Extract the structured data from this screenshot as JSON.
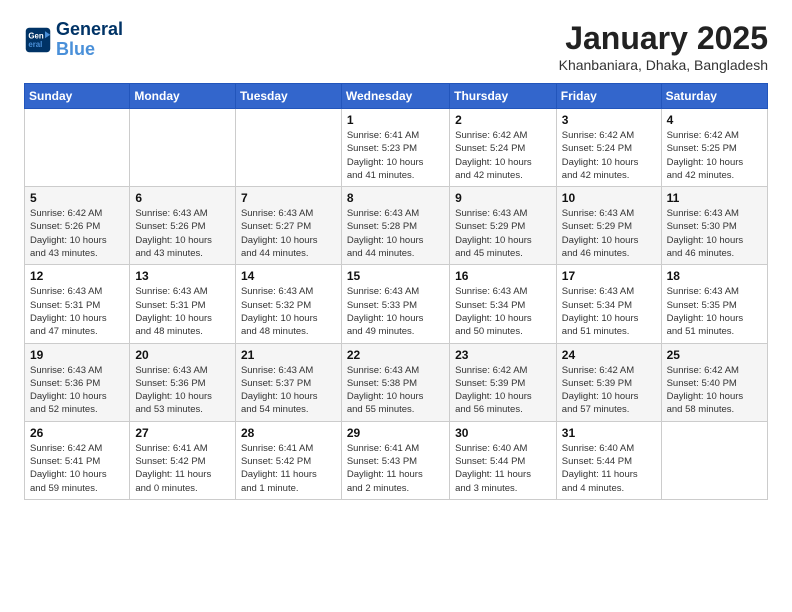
{
  "header": {
    "logo_line1": "General",
    "logo_line2": "Blue",
    "month_title": "January 2025",
    "location": "Khanbaniara, Dhaka, Bangladesh"
  },
  "days_of_week": [
    "Sunday",
    "Monday",
    "Tuesday",
    "Wednesday",
    "Thursday",
    "Friday",
    "Saturday"
  ],
  "weeks": [
    [
      {
        "day": "",
        "info": ""
      },
      {
        "day": "",
        "info": ""
      },
      {
        "day": "",
        "info": ""
      },
      {
        "day": "1",
        "info": "Sunrise: 6:41 AM\nSunset: 5:23 PM\nDaylight: 10 hours\nand 41 minutes."
      },
      {
        "day": "2",
        "info": "Sunrise: 6:42 AM\nSunset: 5:24 PM\nDaylight: 10 hours\nand 42 minutes."
      },
      {
        "day": "3",
        "info": "Sunrise: 6:42 AM\nSunset: 5:24 PM\nDaylight: 10 hours\nand 42 minutes."
      },
      {
        "day": "4",
        "info": "Sunrise: 6:42 AM\nSunset: 5:25 PM\nDaylight: 10 hours\nand 42 minutes."
      }
    ],
    [
      {
        "day": "5",
        "info": "Sunrise: 6:42 AM\nSunset: 5:26 PM\nDaylight: 10 hours\nand 43 minutes."
      },
      {
        "day": "6",
        "info": "Sunrise: 6:43 AM\nSunset: 5:26 PM\nDaylight: 10 hours\nand 43 minutes."
      },
      {
        "day": "7",
        "info": "Sunrise: 6:43 AM\nSunset: 5:27 PM\nDaylight: 10 hours\nand 44 minutes."
      },
      {
        "day": "8",
        "info": "Sunrise: 6:43 AM\nSunset: 5:28 PM\nDaylight: 10 hours\nand 44 minutes."
      },
      {
        "day": "9",
        "info": "Sunrise: 6:43 AM\nSunset: 5:29 PM\nDaylight: 10 hours\nand 45 minutes."
      },
      {
        "day": "10",
        "info": "Sunrise: 6:43 AM\nSunset: 5:29 PM\nDaylight: 10 hours\nand 46 minutes."
      },
      {
        "day": "11",
        "info": "Sunrise: 6:43 AM\nSunset: 5:30 PM\nDaylight: 10 hours\nand 46 minutes."
      }
    ],
    [
      {
        "day": "12",
        "info": "Sunrise: 6:43 AM\nSunset: 5:31 PM\nDaylight: 10 hours\nand 47 minutes."
      },
      {
        "day": "13",
        "info": "Sunrise: 6:43 AM\nSunset: 5:31 PM\nDaylight: 10 hours\nand 48 minutes."
      },
      {
        "day": "14",
        "info": "Sunrise: 6:43 AM\nSunset: 5:32 PM\nDaylight: 10 hours\nand 48 minutes."
      },
      {
        "day": "15",
        "info": "Sunrise: 6:43 AM\nSunset: 5:33 PM\nDaylight: 10 hours\nand 49 minutes."
      },
      {
        "day": "16",
        "info": "Sunrise: 6:43 AM\nSunset: 5:34 PM\nDaylight: 10 hours\nand 50 minutes."
      },
      {
        "day": "17",
        "info": "Sunrise: 6:43 AM\nSunset: 5:34 PM\nDaylight: 10 hours\nand 51 minutes."
      },
      {
        "day": "18",
        "info": "Sunrise: 6:43 AM\nSunset: 5:35 PM\nDaylight: 10 hours\nand 51 minutes."
      }
    ],
    [
      {
        "day": "19",
        "info": "Sunrise: 6:43 AM\nSunset: 5:36 PM\nDaylight: 10 hours\nand 52 minutes."
      },
      {
        "day": "20",
        "info": "Sunrise: 6:43 AM\nSunset: 5:36 PM\nDaylight: 10 hours\nand 53 minutes."
      },
      {
        "day": "21",
        "info": "Sunrise: 6:43 AM\nSunset: 5:37 PM\nDaylight: 10 hours\nand 54 minutes."
      },
      {
        "day": "22",
        "info": "Sunrise: 6:43 AM\nSunset: 5:38 PM\nDaylight: 10 hours\nand 55 minutes."
      },
      {
        "day": "23",
        "info": "Sunrise: 6:42 AM\nSunset: 5:39 PM\nDaylight: 10 hours\nand 56 minutes."
      },
      {
        "day": "24",
        "info": "Sunrise: 6:42 AM\nSunset: 5:39 PM\nDaylight: 10 hours\nand 57 minutes."
      },
      {
        "day": "25",
        "info": "Sunrise: 6:42 AM\nSunset: 5:40 PM\nDaylight: 10 hours\nand 58 minutes."
      }
    ],
    [
      {
        "day": "26",
        "info": "Sunrise: 6:42 AM\nSunset: 5:41 PM\nDaylight: 10 hours\nand 59 minutes."
      },
      {
        "day": "27",
        "info": "Sunrise: 6:41 AM\nSunset: 5:42 PM\nDaylight: 11 hours\nand 0 minutes."
      },
      {
        "day": "28",
        "info": "Sunrise: 6:41 AM\nSunset: 5:42 PM\nDaylight: 11 hours\nand 1 minute."
      },
      {
        "day": "29",
        "info": "Sunrise: 6:41 AM\nSunset: 5:43 PM\nDaylight: 11 hours\nand 2 minutes."
      },
      {
        "day": "30",
        "info": "Sunrise: 6:40 AM\nSunset: 5:44 PM\nDaylight: 11 hours\nand 3 minutes."
      },
      {
        "day": "31",
        "info": "Sunrise: 6:40 AM\nSunset: 5:44 PM\nDaylight: 11 hours\nand 4 minutes."
      },
      {
        "day": "",
        "info": ""
      }
    ]
  ]
}
